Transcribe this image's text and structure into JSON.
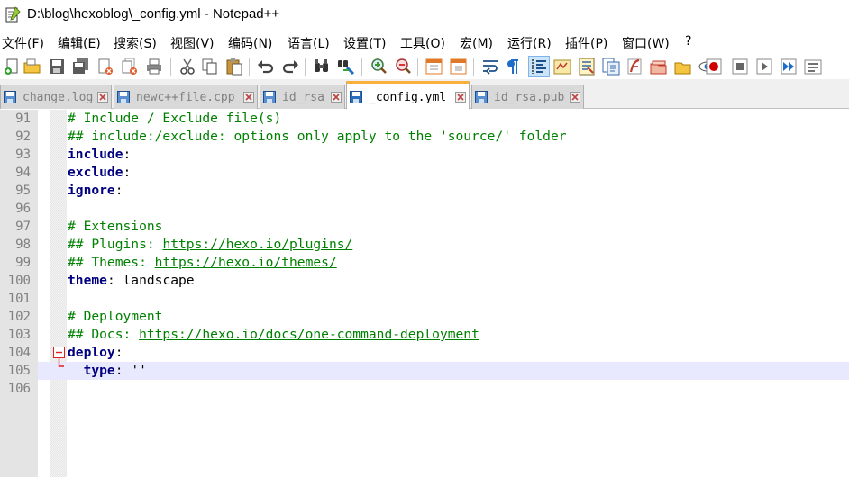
{
  "window": {
    "title": "D:\\blog\\hexoblog\\_config.yml - Notepad++"
  },
  "menu": [
    "文件(F)",
    "编辑(E)",
    "搜索(S)",
    "视图(V)",
    "编码(N)",
    "语言(L)",
    "设置(T)",
    "工具(O)",
    "宏(M)",
    "运行(R)",
    "插件(P)",
    "窗口(W)",
    "?"
  ],
  "toolbar": {
    "buttons": [
      "new-file-icon",
      "open-file-icon",
      "save-icon",
      "save-all-icon",
      "close-icon",
      "close-all-icon",
      "print-icon",
      "cut-icon",
      "copy-icon",
      "paste-icon",
      "undo-icon",
      "redo-icon",
      "find-icon",
      "replace-icon",
      "zoom-in-icon",
      "zoom-out-icon",
      "sync-vertical-icon",
      "sync-horizontal-icon",
      "word-wrap-icon",
      "show-all-chars-icon",
      "indent-guide-icon",
      "user-defined-lang-icon",
      "doc-map-icon",
      "function-list-icon",
      "folder-workspace-icon",
      "pdf-icon",
      "folder-icon",
      "monitor-eye-icon",
      "record-macro-icon",
      "stop-record-icon",
      "play-macro-icon",
      "run-macro-multiple-icon",
      "save-macro-icon"
    ],
    "colors": {
      "accent": "#1d6dc9",
      "record": "#d00000"
    }
  },
  "tabs": [
    {
      "label": "change.log",
      "active": false
    },
    {
      "label": "newc++file.cpp",
      "active": false
    },
    {
      "label": "id_rsa",
      "active": false
    },
    {
      "label": "_config.yml",
      "active": true
    },
    {
      "label": "id_rsa.pub",
      "active": false
    }
  ],
  "editor": {
    "colors": {
      "comment": "#008000",
      "key": "#000080",
      "current_line": "#e8e8ff",
      "tab_accent": "#fab03c"
    },
    "current_line": 105,
    "lines": [
      {
        "n": "91",
        "tokens": [
          {
            "t": "comment",
            "v": "# Include / Exclude file(s)"
          }
        ]
      },
      {
        "n": "92",
        "tokens": [
          {
            "t": "comment",
            "v": "## include:/exclude: options only apply to the 'source/' folder"
          }
        ]
      },
      {
        "n": "93",
        "tokens": [
          {
            "t": "key",
            "v": "include"
          },
          {
            "t": "plain",
            "v": ":"
          }
        ]
      },
      {
        "n": "94",
        "tokens": [
          {
            "t": "key",
            "v": "exclude"
          },
          {
            "t": "plain",
            "v": ":"
          }
        ]
      },
      {
        "n": "95",
        "tokens": [
          {
            "t": "key",
            "v": "ignore"
          },
          {
            "t": "plain",
            "v": ":"
          }
        ]
      },
      {
        "n": "96",
        "tokens": []
      },
      {
        "n": "97",
        "tokens": [
          {
            "t": "comment",
            "v": "# Extensions"
          }
        ]
      },
      {
        "n": "98",
        "tokens": [
          {
            "t": "comment",
            "v": "## Plugins: "
          },
          {
            "t": "link",
            "v": "https://hexo.io/plugins/"
          }
        ]
      },
      {
        "n": "99",
        "tokens": [
          {
            "t": "comment",
            "v": "## Themes: "
          },
          {
            "t": "link",
            "v": "https://hexo.io/themes/"
          }
        ]
      },
      {
        "n": "100",
        "tokens": [
          {
            "t": "key",
            "v": "theme"
          },
          {
            "t": "plain",
            "v": ": landscape"
          }
        ]
      },
      {
        "n": "101",
        "tokens": []
      },
      {
        "n": "102",
        "tokens": [
          {
            "t": "comment",
            "v": "# Deployment"
          }
        ]
      },
      {
        "n": "103",
        "tokens": [
          {
            "t": "comment",
            "v": "## Docs: "
          },
          {
            "t": "link",
            "v": "https://hexo.io/docs/one-command-deployment"
          }
        ]
      },
      {
        "n": "104",
        "fold": "open",
        "tokens": [
          {
            "t": "key",
            "v": "deploy"
          },
          {
            "t": "plain",
            "v": ":"
          }
        ]
      },
      {
        "n": "105",
        "fold": "end",
        "tokens": [
          {
            "t": "plain",
            "v": "  "
          },
          {
            "t": "key",
            "v": "type"
          },
          {
            "t": "plain",
            "v": ": "
          },
          {
            "t": "string",
            "v": "''"
          }
        ]
      },
      {
        "n": "106",
        "tokens": []
      }
    ]
  }
}
